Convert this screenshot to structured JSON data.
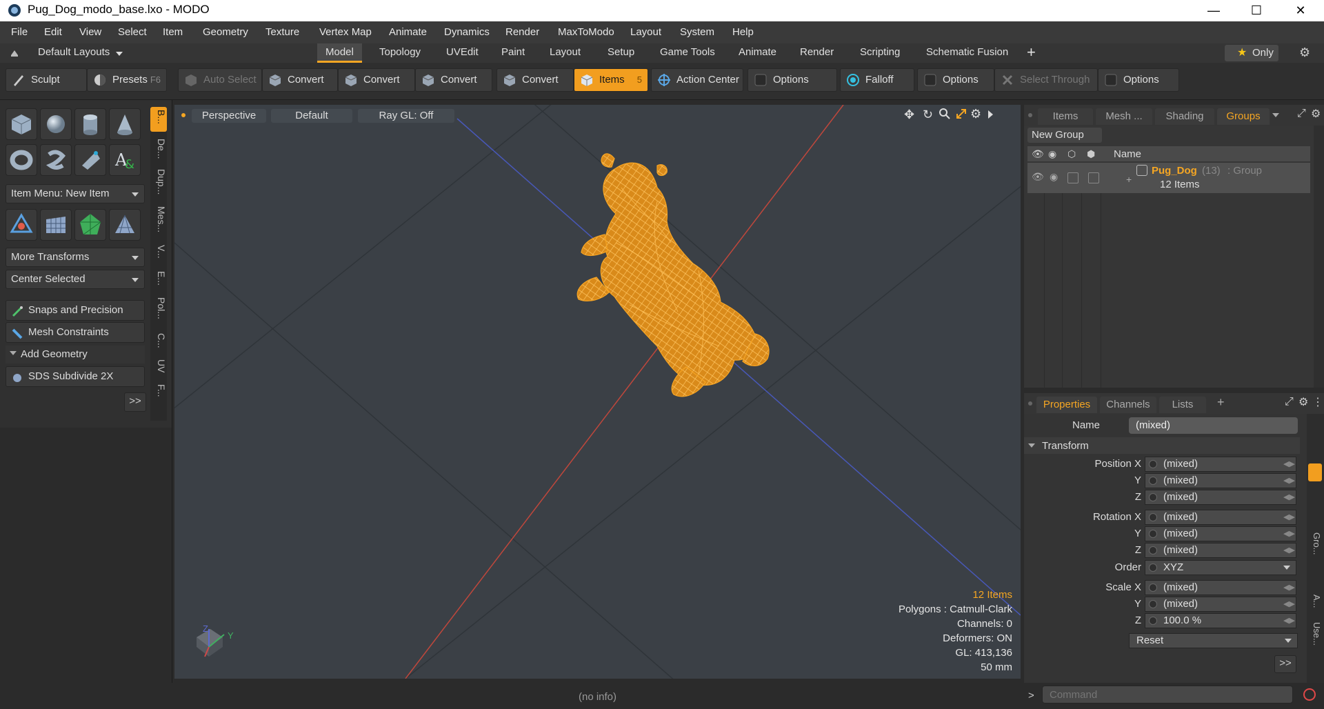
{
  "window": {
    "title": "Pug_Dog_modo_base.lxo - MODO",
    "min": "—",
    "max": "☐",
    "close": "✕"
  },
  "menu": [
    "File",
    "Edit",
    "View",
    "Select",
    "Item",
    "Geometry",
    "Texture",
    "Vertex Map",
    "Animate",
    "Dynamics",
    "Render",
    "MaxToModo",
    "Layout",
    "System",
    "Help"
  ],
  "layouts": {
    "selector": "Default Layouts",
    "tabs": [
      "Model",
      "Topology",
      "UVEdit",
      "Paint",
      "Layout",
      "Setup",
      "Game Tools",
      "Animate",
      "Render",
      "Scripting",
      "Schematic Fusion"
    ],
    "active": "Model",
    "add": "+",
    "only": "Only"
  },
  "toolbar": {
    "sculpt": "Sculpt",
    "presets": "Presets",
    "presets_key": "F6",
    "auto_select": "Auto Select",
    "convert": "Convert",
    "items": "Items",
    "items_key": "5",
    "action_center": "Action Center",
    "options": "Options",
    "falloff": "Falloff",
    "select_through": "Select Through"
  },
  "left": {
    "item_menu": "Item Menu: New Item",
    "more_transforms": "More Transforms",
    "center_selected": "Center Selected",
    "snaps": "Snaps and Precision",
    "mesh_constraints": "Mesh Constraints",
    "add_geometry": "Add Geometry",
    "sds": "SDS Subdivide 2X",
    "more": ">>",
    "vtabs": [
      "B...",
      "De...",
      "Dup...",
      "Mes...",
      "V...",
      "E...",
      "Pol...",
      "C...",
      "UV",
      "F..."
    ]
  },
  "viewport": {
    "view": "Perspective",
    "shading": "Default",
    "raygl": "Ray GL: Off",
    "info": {
      "items": "12 Items",
      "polygons": "Polygons : Catmull-Clark",
      "channels": "Channels: 0",
      "deformers": "Deformers: ON",
      "gl": "GL: 413,136",
      "scale": "50 mm"
    },
    "axis": {
      "z": "Z",
      "y": "Y"
    },
    "colors": {
      "bg": "#3b4046",
      "mesh": "#f7a523",
      "xaxis": "#c0473c",
      "zaxis": "#4858b8"
    }
  },
  "right_tabs": [
    "Items",
    "Mesh ...",
    "Shading",
    "Groups"
  ],
  "right_active": "Groups",
  "groups": {
    "new_group": "New Group",
    "col_name": "Name",
    "row_name": "Pug_Dog",
    "row_count": "(13)",
    "row_type": ": Group",
    "row_items": "12 Items"
  },
  "prop_tabs": [
    "Properties",
    "Channels",
    "Lists"
  ],
  "prop_add": "+",
  "props": {
    "name_label": "Name",
    "name_value": "(mixed)",
    "section": "Transform",
    "pos_x": "Position X",
    "rot_x": "Rotation X",
    "order": "Order",
    "order_value": "XYZ",
    "scale_x": "Scale X",
    "y": "Y",
    "z": "Z",
    "mixed": "(mixed)",
    "scale_z_value": "100.0 %",
    "reset": "Reset",
    "more": ">>",
    "side_tabs": [
      "Gro...",
      "A...",
      "Use..."
    ]
  },
  "status": {
    "info": "(no info)",
    "cmd_placeholder": "Command",
    "cmd_prompt": ">"
  }
}
